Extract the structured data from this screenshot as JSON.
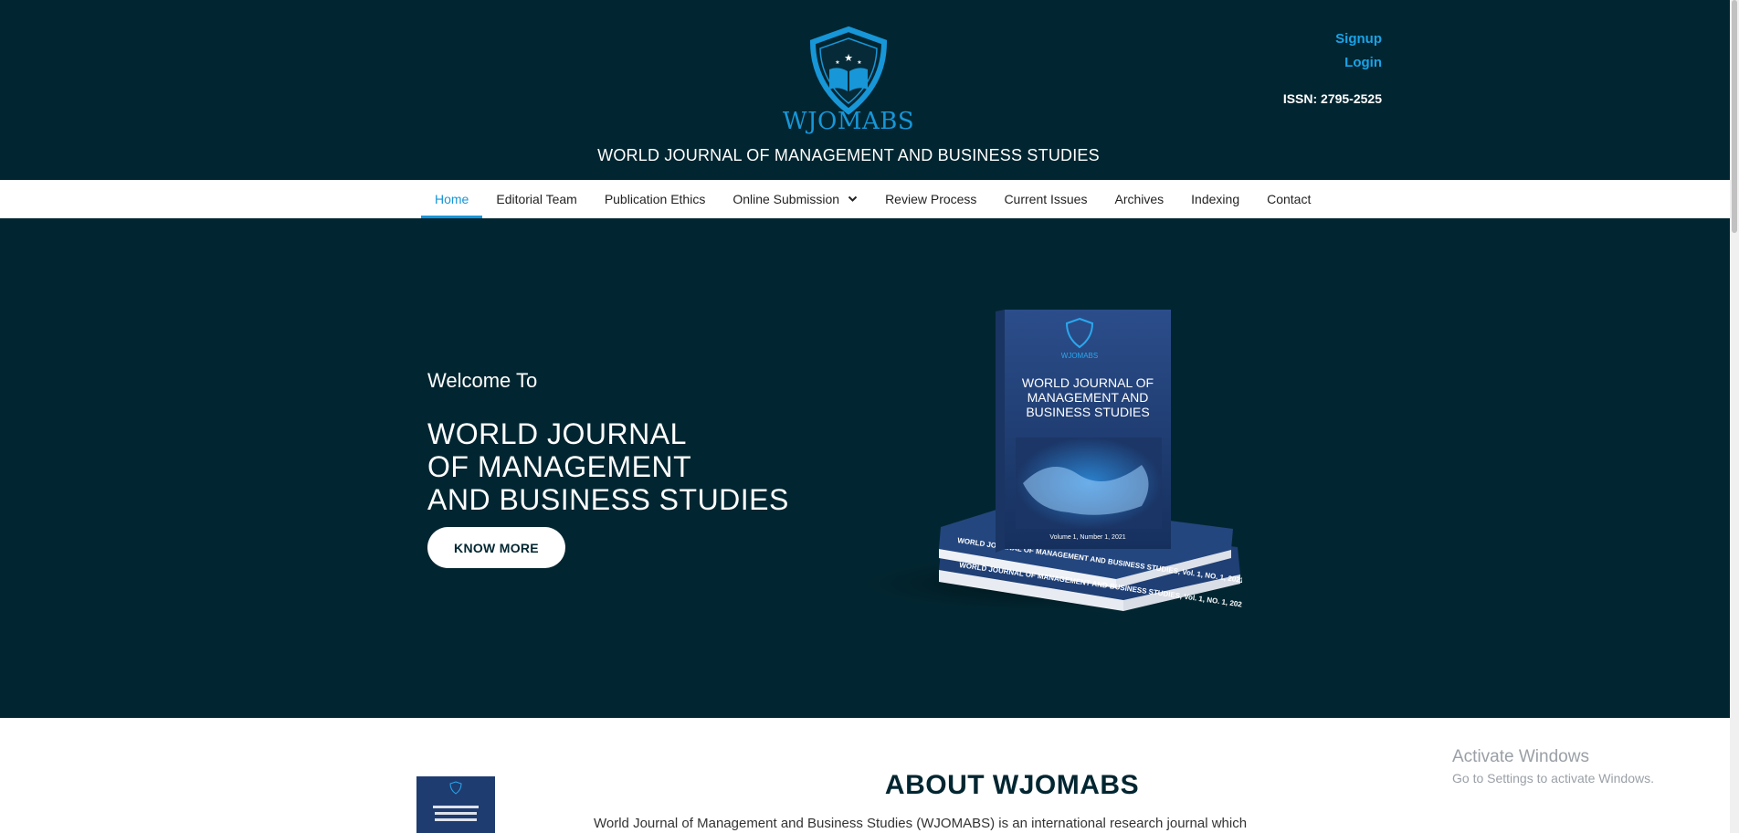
{
  "header": {
    "brand": "WJOMABS",
    "journal_title": "WORLD JOURNAL OF MANAGEMENT AND BUSINESS STUDIES",
    "signup": "Signup",
    "login": "Login",
    "issn": "ISSN: 2795-2525"
  },
  "nav": {
    "items": [
      {
        "label": "Home"
      },
      {
        "label": "Editorial Team"
      },
      {
        "label": "Publication Ethics"
      },
      {
        "label": "Online Submission"
      },
      {
        "label": "Review Process"
      },
      {
        "label": "Current Issues"
      },
      {
        "label": "Archives"
      },
      {
        "label": "Indexing"
      },
      {
        "label": "Contact"
      }
    ]
  },
  "hero": {
    "welcome": "Welcome To",
    "title_lines": [
      "WORLD JOURNAL",
      "OF MANAGEMENT",
      "AND BUSINESS STUDIES"
    ],
    "button": "KNOW MORE",
    "book": {
      "brand": "WJOMABS",
      "cover_title_lines": [
        "WORLD JOURNAL OF",
        "MANAGEMENT AND",
        "BUSINESS STUDIES"
      ],
      "volume": "Volume 1, Number 1, 2021",
      "spine": "WORLD JOURNAL OF MANAGEMENT AND BUSINESS STUDIES, Vol. 1, NO. 1, 2021"
    }
  },
  "about": {
    "title": "ABOUT WJOMABS",
    "text": "World Journal of Management and Business Studies (WJOMABS) is an international research journal which"
  },
  "windows_watermark": {
    "line1": "Activate Windows",
    "line2": "Go to Settings to activate Windows."
  },
  "colors": {
    "header_bg": "#022631",
    "accent": "#1796d8",
    "link": "#1aa3e8"
  }
}
